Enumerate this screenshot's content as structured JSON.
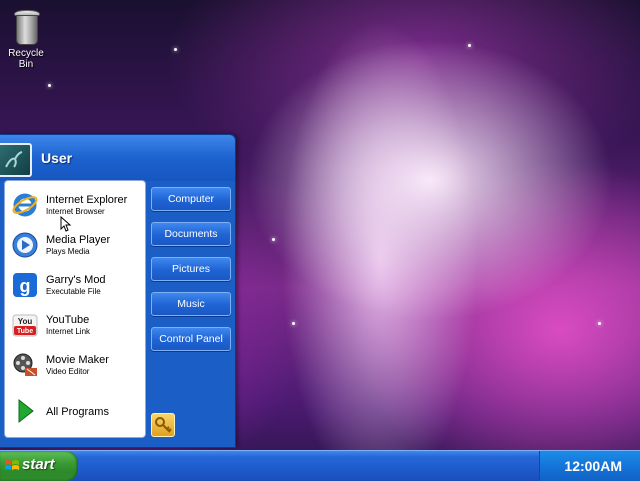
{
  "desktop": {
    "icons": [
      {
        "label": "Recycle Bin",
        "icon": "recycle-bin-icon"
      }
    ]
  },
  "start_menu": {
    "user_name": "User",
    "programs": [
      {
        "name": "Internet Explorer",
        "description": "Internet Browser",
        "icon": "internet-explorer-icon"
      },
      {
        "name": "Media Player",
        "description": "Plays Media",
        "icon": "media-player-icon"
      },
      {
        "name": "Garry's Mod",
        "description": "Executable File",
        "icon": "garrys-mod-icon"
      },
      {
        "name": "YouTube",
        "description": "Internet Link",
        "icon": "youtube-icon"
      },
      {
        "name": "Movie Maker",
        "description": "Video Editor",
        "icon": "movie-maker-icon"
      }
    ],
    "all_programs_label": "All Programs",
    "places": [
      {
        "label": "Computer"
      },
      {
        "label": "Documents"
      },
      {
        "label": "Pictures"
      },
      {
        "label": "Music"
      },
      {
        "label": "Control Panel"
      }
    ],
    "logoff_icon": "key-icon"
  },
  "taskbar": {
    "start_label": "start",
    "clock": "12:00AM"
  },
  "colors": {
    "taskbar_blue": "#1d58c8",
    "start_green": "#3a9a34",
    "menu_blue": "#1a5ec6"
  }
}
